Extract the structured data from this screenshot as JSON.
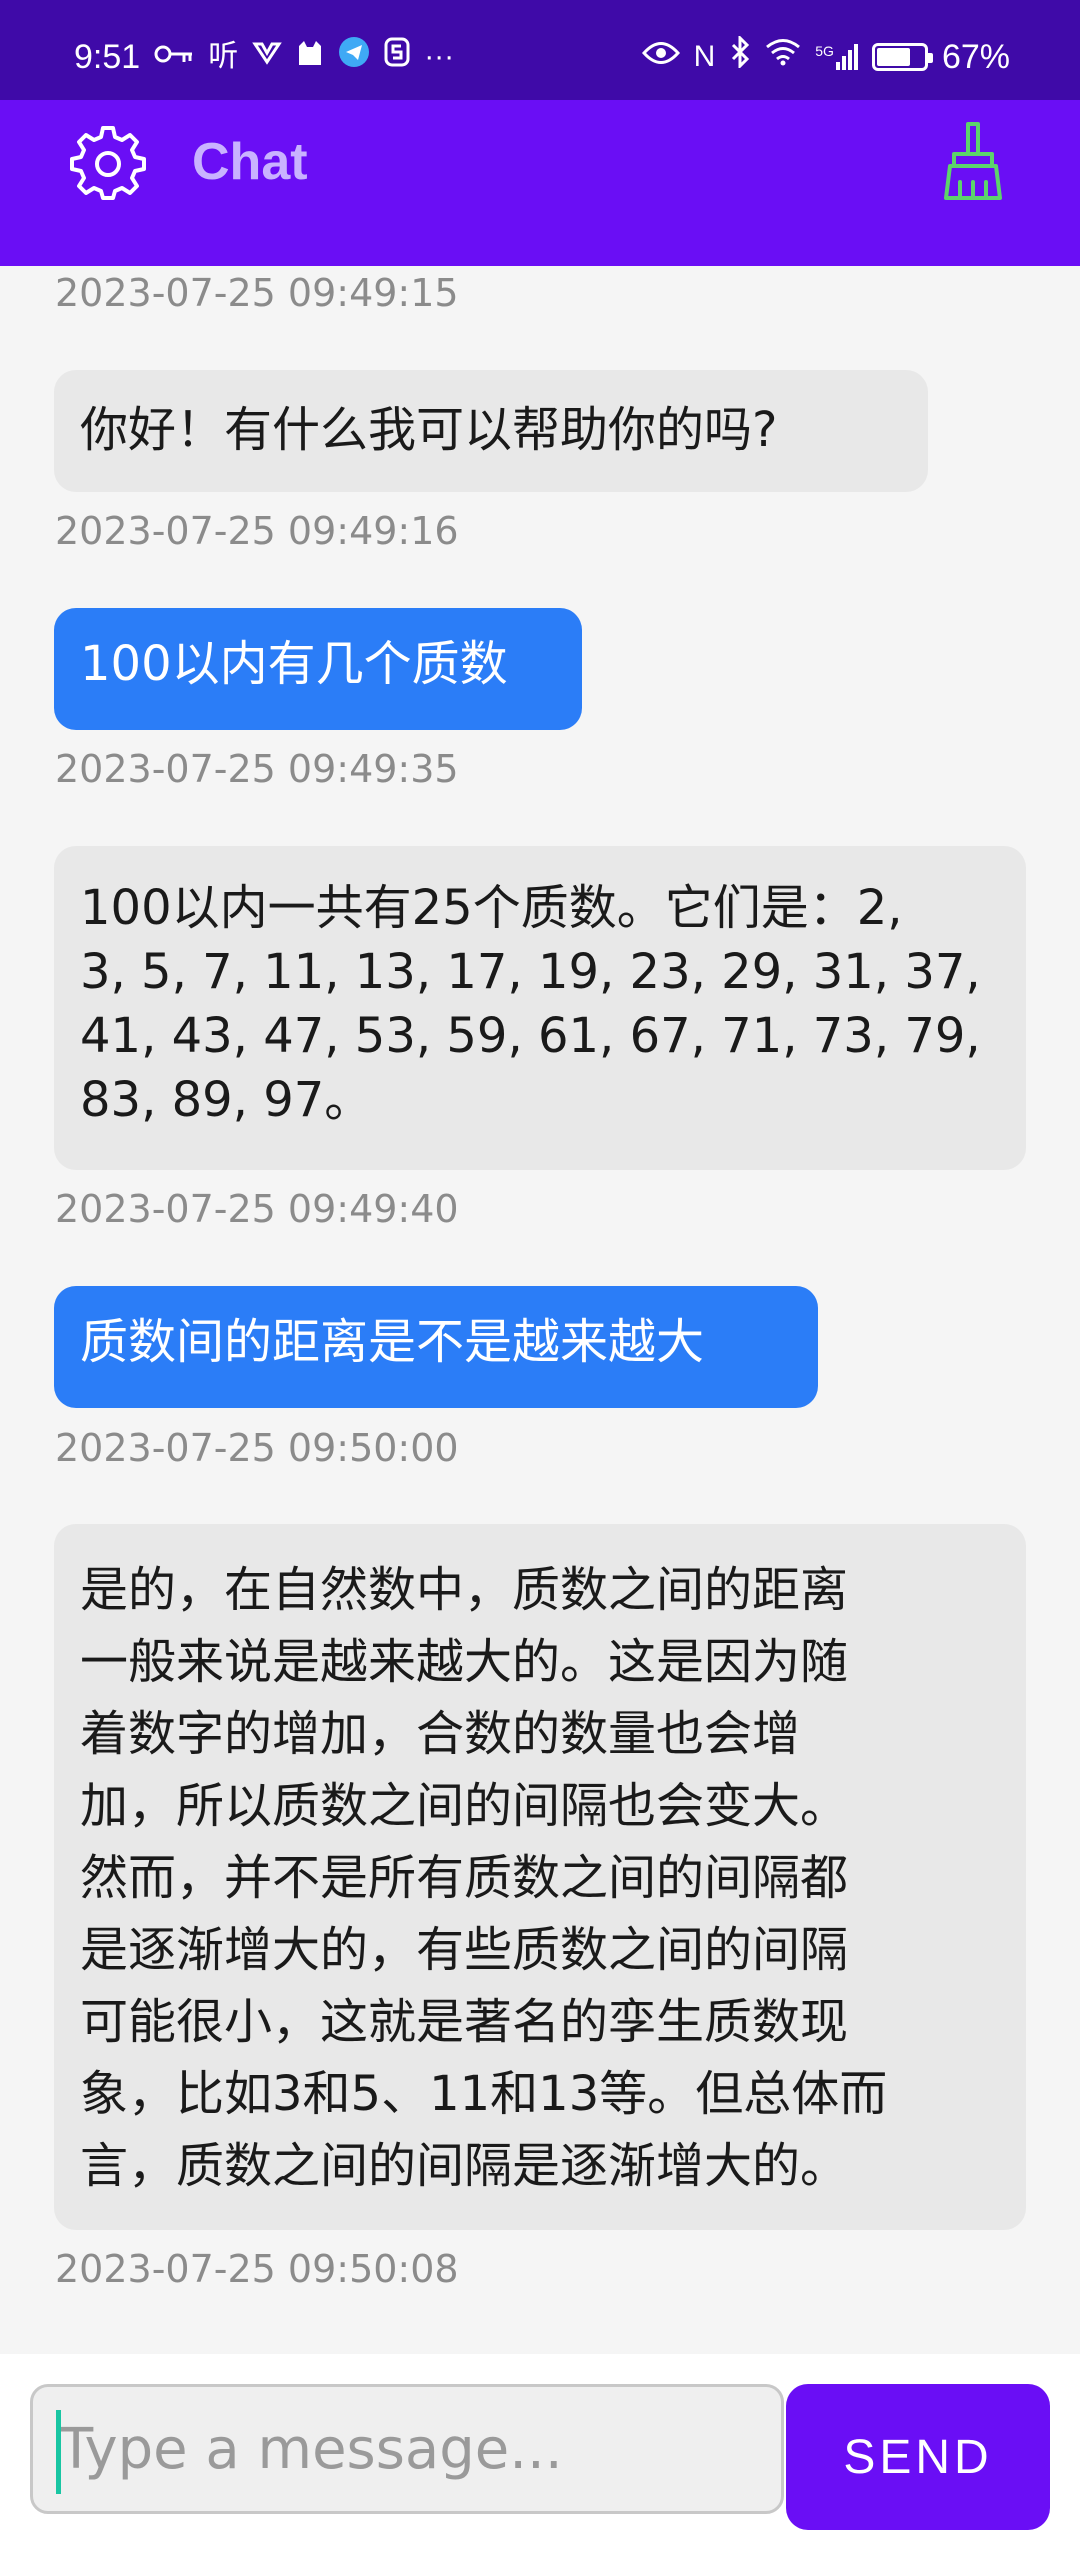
{
  "status_bar": {
    "time": "9:51",
    "left_icons": [
      "key-icon",
      "ting-app-icon",
      "app-icon",
      "cat-icon",
      "telegram-icon",
      "s-app-icon",
      "more-icon"
    ],
    "ting_label": "听",
    "more_label": "···",
    "right_icons": [
      "eye-icon",
      "nfc-icon",
      "bluetooth-icon",
      "wifi-icon",
      "signal-5g-icon",
      "battery-icon"
    ],
    "nfc_label": "N",
    "net_label": "5G",
    "battery_percent": "67%",
    "battery_level": 0.67
  },
  "app_bar": {
    "title": "Chat",
    "settings_icon": "gear-icon",
    "clear_icon": "broom-icon",
    "title_color": "#c9b3ff",
    "background": "#6a0ef5",
    "broom_color": "#5cd46b"
  },
  "messages": [
    {
      "sender": "bot",
      "text": "",
      "time": "2023-07-25 09:49:15"
    },
    {
      "sender": "bot",
      "text": "你好！有什么我可以帮助你的吗?",
      "time": "2023-07-25 09:49:16"
    },
    {
      "sender": "user",
      "text": "100以内有几个质数",
      "time": "2023-07-25 09:49:35"
    },
    {
      "sender": "bot",
      "text": "100以内一共有25个质数。它们是：2,\n3, 5, 7, 11, 13, 17, 19, 23, 29, 31, 37,\n41, 43, 47, 53, 59, 61, 67, 71, 73, 79,\n83, 89, 97。",
      "time": "2023-07-25 09:49:40"
    },
    {
      "sender": "user",
      "text": "质数间的距离是不是越来越大",
      "time": "2023-07-25 09:50:00"
    },
    {
      "sender": "bot",
      "text": "是的，在自然数中，质数之间的距离\n一般来说是越来越大的。这是因为随\n着数字的增加，合数的数量也会增\n加，所以质数之间的间隔也会变大。\n然而，并不是所有质数之间的间隔都\n是逐渐增大的，有些质数之间的间隔\n可能很小，这就是著名的孪生质数现\n象，比如3和5、11和13等。但总体而\n言，质数之间的间隔是逐渐增大的。",
      "time": "2023-07-25 09:50:08"
    }
  ],
  "input": {
    "placeholder": "Type a message...",
    "value": ""
  },
  "send_button": {
    "label": "SEND"
  },
  "colors": {
    "user_bubble": "#2b7df7",
    "bot_bubble": "#e8e8e8",
    "accent": "#6a0ef5",
    "status_bar": "#3f0aa8"
  }
}
